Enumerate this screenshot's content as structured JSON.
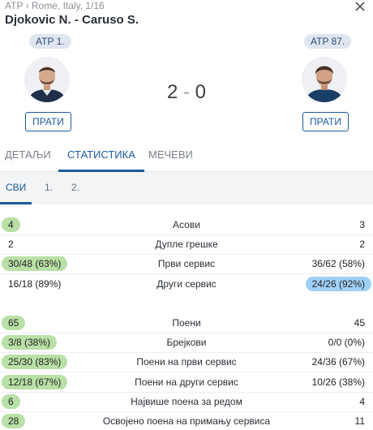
{
  "header": {
    "breadcrumb": "ATP › Rome, Italy, 1/16",
    "title": "Djokovic N. - Caruso S."
  },
  "players": {
    "home": {
      "rank": "ATP 1.",
      "follow_label": "ПРАТИ"
    },
    "away": {
      "rank": "ATP 87.",
      "follow_label": "ПРАТИ"
    }
  },
  "score": {
    "home": "2",
    "separator": "-",
    "away": "0"
  },
  "tabs": [
    {
      "label": "ДЕТАЉИ"
    },
    {
      "label": "СТАТИСТИКА",
      "active": true
    },
    {
      "label": "МЕЧЕВИ"
    }
  ],
  "subtabs": [
    {
      "label": "СВИ",
      "active": true
    },
    {
      "label": "1."
    },
    {
      "label": "2."
    }
  ],
  "colors": {
    "accent": "#1d5a9e",
    "better_home": "#b9e0a6",
    "better_away": "#9fd0f5"
  },
  "stats": {
    "serve": [
      {
        "home": "4",
        "label": "Асови",
        "away": "3",
        "highlight": "home"
      },
      {
        "home": "2",
        "label": "Дупле грешке",
        "away": "2",
        "highlight": "none"
      },
      {
        "home": "30/48 (63%)",
        "label": "Први сервис",
        "away": "36/62 (58%)",
        "highlight": "home"
      },
      {
        "home": "16/18 (89%)",
        "label": "Други сервис",
        "away": "24/26 (92%)",
        "highlight": "away"
      }
    ],
    "points": [
      {
        "home": "65",
        "label": "Поени",
        "away": "45",
        "highlight": "home"
      },
      {
        "home": "3/8 (38%)",
        "label": "Брејкови",
        "away": "0/0 (0%)",
        "highlight": "home"
      },
      {
        "home": "25/30 (83%)",
        "label": "Поени на први сервис",
        "away": "24/36 (67%)",
        "highlight": "home"
      },
      {
        "home": "12/18 (67%)",
        "label": "Поени на други сервис",
        "away": "10/26 (38%)",
        "highlight": "home"
      },
      {
        "home": "6",
        "label": "Највише поена за редом",
        "away": "4",
        "highlight": "home"
      },
      {
        "home": "28",
        "label": "Освојено поена на примању сервиса",
        "away": "11",
        "highlight": "home"
      }
    ]
  }
}
